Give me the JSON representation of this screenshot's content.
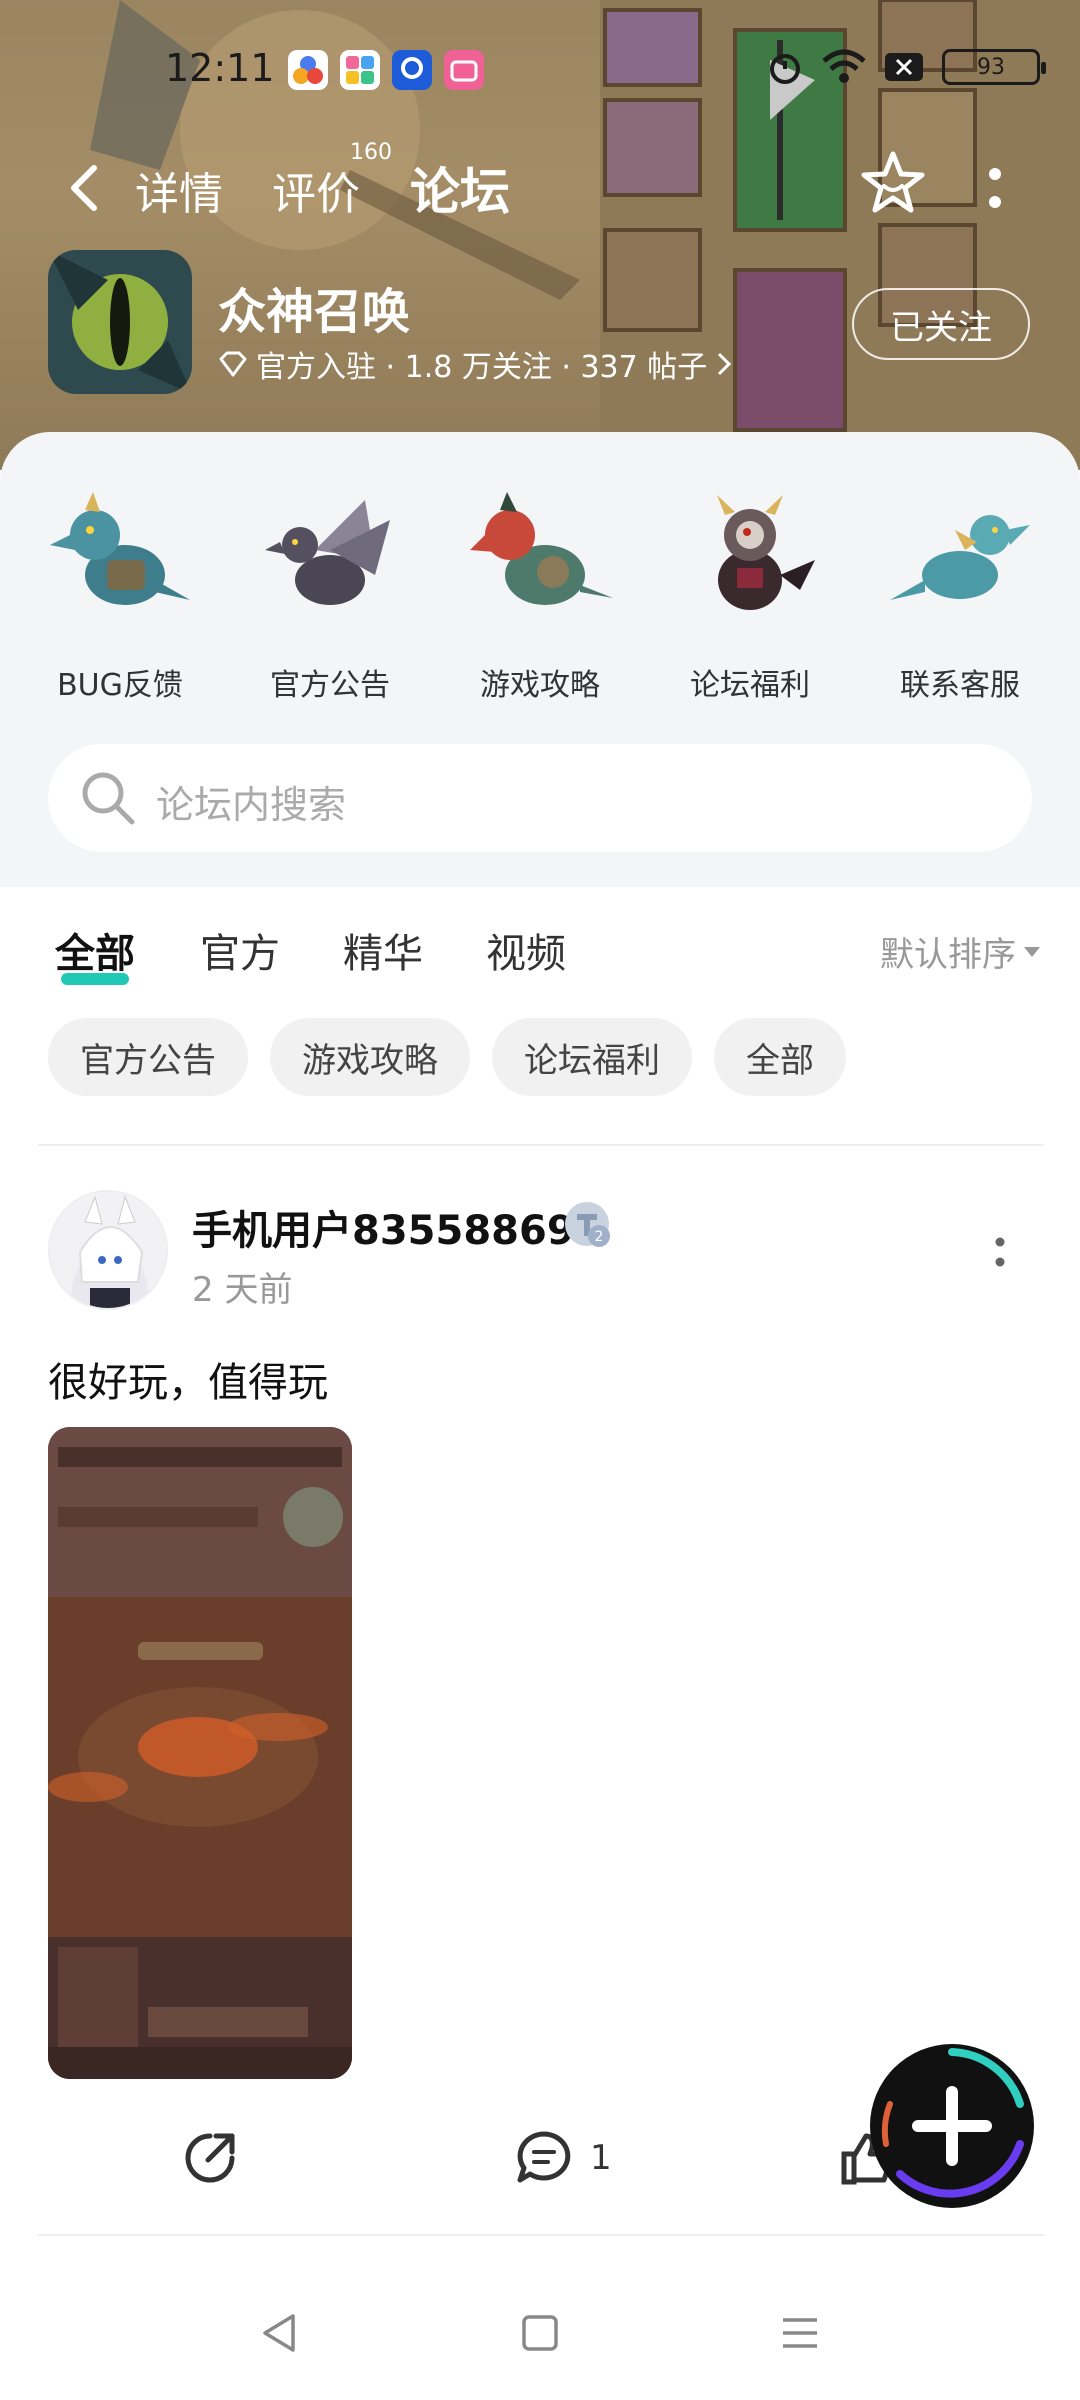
{
  "status_bar": {
    "time": "12:11",
    "battery": "93"
  },
  "nav": {
    "tabs": [
      {
        "label": "详情"
      },
      {
        "label": "评价",
        "badge": "160"
      },
      {
        "label": "论坛"
      }
    ],
    "active_tab": "论坛"
  },
  "app": {
    "name": "众神召唤",
    "meta": "官方入驻 · 1.8 万关注 · 337 帖子",
    "follow_label": "已关注"
  },
  "categories": [
    {
      "label": "BUG反馈",
      "icon": "dragon-blue-icon"
    },
    {
      "label": "官方公告",
      "icon": "dragon-winged-icon"
    },
    {
      "label": "游戏攻略",
      "icon": "dragon-red-icon"
    },
    {
      "label": "论坛福利",
      "icon": "armored-demon-icon"
    },
    {
      "label": "联系客服",
      "icon": "dragon-teal-icon"
    }
  ],
  "search": {
    "placeholder": "论坛内搜索"
  },
  "filter_tabs": [
    {
      "label": "全部"
    },
    {
      "label": "官方"
    },
    {
      "label": "精华"
    },
    {
      "label": "视频"
    }
  ],
  "active_filter": "全部",
  "sort_label": "默认排序",
  "chips": [
    {
      "label": "官方公告"
    },
    {
      "label": "游戏攻略"
    },
    {
      "label": "论坛福利"
    },
    {
      "label": "全部"
    }
  ],
  "post": {
    "username": "手机用户83558869",
    "level": "2",
    "time": "2 天前",
    "text": "很好玩，值得玩",
    "comment_count": "1"
  },
  "colors": {
    "accent": "#22c8b6",
    "header_bg": "#a48d66",
    "panel_bg": "#f4f5f7",
    "fab": "#111111"
  }
}
